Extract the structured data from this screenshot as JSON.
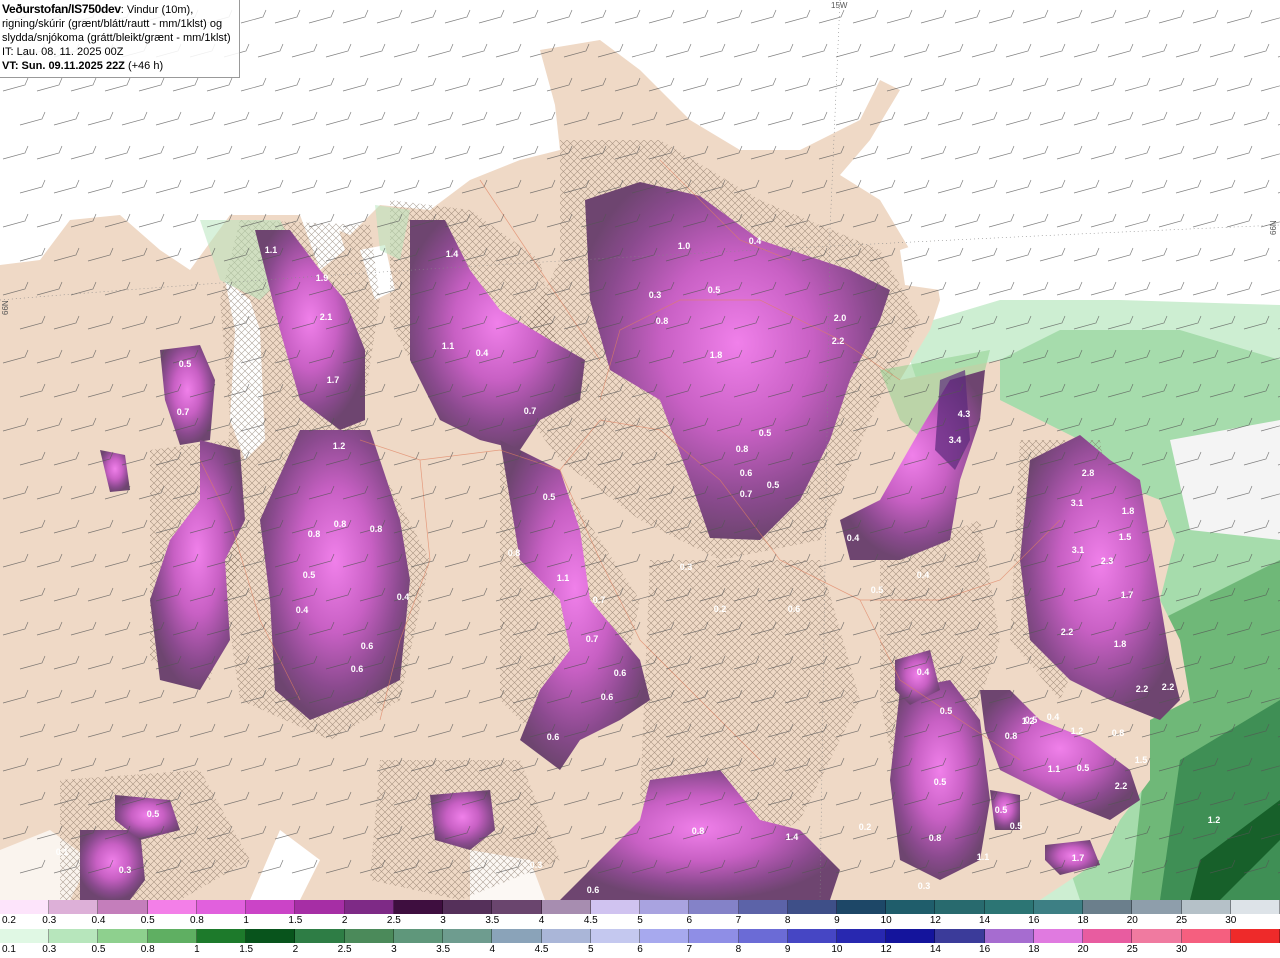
{
  "header": {
    "title": "Veðurstofan/IS750dev",
    "line1_rest": ": Vindur (10m),",
    "line2": "rigning/skúrir (grænt/blátt/rautt - mm/1klst) og",
    "line3": "slydda/snjókoma (grátt/bleikt/grænt - mm/1klst)",
    "it": "IT: Lau. 08. 11. 2025 00Z",
    "vt_label": "VT: Sun. 09.11.2025 22Z",
    "vt_lead": " (+46 h)"
  },
  "grid_labels": {
    "lon_top": "15W",
    "lat_left": "66N",
    "lat_right": "66N"
  },
  "legend_snow": {
    "labels": [
      "0.2",
      "0.3",
      "0.4",
      "0.5",
      "0.8",
      "1",
      "1.5",
      "2",
      "2.5",
      "3",
      "3.5",
      "4",
      "4.5",
      "5",
      "6",
      "7",
      "8",
      "9",
      "10",
      "12",
      "14",
      "16",
      "18",
      "20",
      "25",
      "30"
    ],
    "colors": [
      "#fde4fb",
      "#ddb0d8",
      "#c47ebb",
      "#f37fe8",
      "#e160dd",
      "#cb44c7",
      "#a62ea5",
      "#7e2a86",
      "#3e0e3f",
      "#55305a",
      "#6a456e",
      "#a78db0",
      "#d0c3f0",
      "#a9a3e0",
      "#8482c8",
      "#5c63a8",
      "#3e4f88",
      "#1d4767",
      "#1f5d6b",
      "#286a6e",
      "#2c7574",
      "#3d7f84",
      "#6b7f8c",
      "#8e9eab",
      "#b5c1c8",
      "#dde3e8"
    ]
  },
  "legend_rain": {
    "labels": [
      "0.1",
      "0.3",
      "0.5",
      "0.8",
      "1",
      "1.5",
      "2",
      "2.5",
      "3",
      "3.5",
      "4",
      "4.5",
      "5",
      "6",
      "7",
      "8",
      "9",
      "10",
      "12",
      "14",
      "16",
      "18",
      "20",
      "25",
      "30"
    ],
    "colors": [
      "#e0f8e4",
      "#b7e6bc",
      "#8ed08e",
      "#5faf62",
      "#1d7a2b",
      "#08541c",
      "#2e7d45",
      "#4b8a5a",
      "#5f977b",
      "#6e9c8f",
      "#8aa3b9",
      "#aab6d8",
      "#c4c8ef",
      "#a7a9ee",
      "#8f8ee6",
      "#6b6bd6",
      "#4646c4",
      "#2828b0",
      "#14149c",
      "#3b3b9a",
      "#a66cd0",
      "#e07ae0",
      "#e85ca0",
      "#f07aa0",
      "#f55f7f",
      "#ee2a2a"
    ]
  },
  "value_labels": [
    "1.0",
    "0.4",
    "2.0",
    "2.2",
    "0.5",
    "0.3",
    "0.8",
    "1.8",
    "0.5",
    "0.8",
    "0.6",
    "0.5",
    "0.7",
    "0.4",
    "4.3",
    "3.4",
    "1.1",
    "1.9",
    "2.1",
    "1.7",
    "1.4",
    "1.1",
    "0.4",
    "0.7",
    "1.2",
    "0.8",
    "0.8",
    "0.8",
    "0.5",
    "0.4",
    "0.4",
    "0.6",
    "0.6",
    "0.5",
    "0.8",
    "1.1",
    "0.7",
    "0.7",
    "0.6",
    "0.6",
    "0.6",
    "0.3",
    "0.6",
    "0.4",
    "0.5",
    "0.5",
    "1.2",
    "0.8",
    "0.5",
    "0.2",
    "0.2",
    "0.4",
    "0.5",
    "0.4",
    "2.8",
    "3.1",
    "1.8",
    "1.5",
    "3.1",
    "2.3",
    "1.7",
    "2.2",
    "1.8",
    "2.2",
    "2.2",
    "1.2",
    "1.1",
    "2.2",
    "1.5",
    "0.8",
    "0.3",
    "0.5",
    "0.8",
    "1.4",
    "0.5",
    "0.8",
    "1.1",
    "0.5",
    "0.3",
    "0.6",
    "0.3",
    "0.5",
    "1.7",
    "0.1",
    "0.7",
    "0.5",
    "1.2"
  ]
}
